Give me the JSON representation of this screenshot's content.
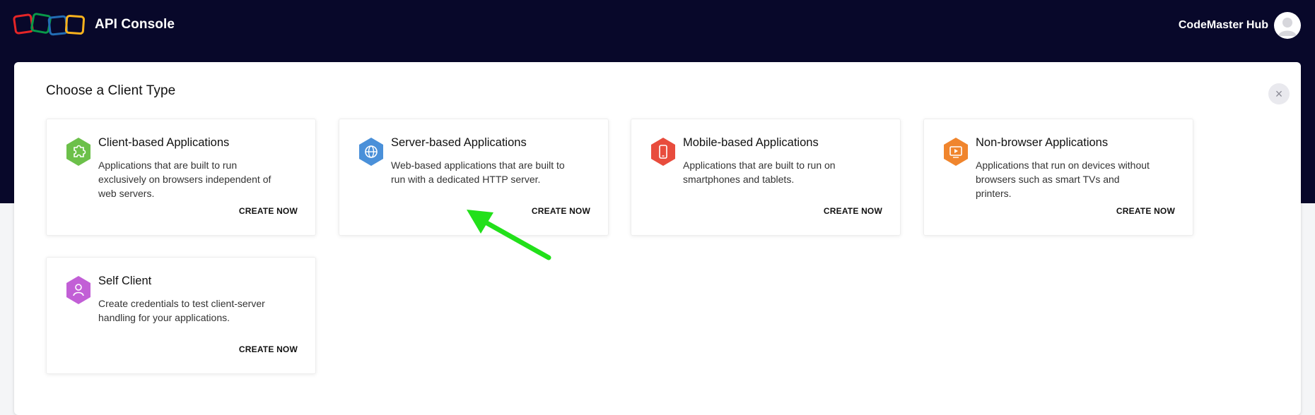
{
  "header": {
    "app_title": "API Console",
    "user_name": "CodeMaster Hub"
  },
  "modal": {
    "title": "Choose a Client Type",
    "close_label": "×"
  },
  "cards": [
    {
      "title": "Client-based Applications",
      "description": "Applications that are built to run exclusively on browsers independent of web servers.",
      "cta": "CREATE NOW",
      "icon": "puzzle-icon",
      "color": "#6cc04a"
    },
    {
      "title": "Server-based Applications",
      "description": "Web-based applications that are built to run with a dedicated HTTP server.",
      "cta": "CREATE NOW",
      "icon": "globe-icon",
      "color": "#4a90d9"
    },
    {
      "title": "Mobile-based Applications",
      "description": "Applications that are built to run on smartphones and tablets.",
      "cta": "CREATE NOW",
      "icon": "smartphone-icon",
      "color": "#e84c3d"
    },
    {
      "title": "Non-browser Applications",
      "description": "Applications that run on devices without browsers such as smart TVs and printers.",
      "cta": "CREATE NOW",
      "icon": "tv-play-icon",
      "color": "#f0852d"
    },
    {
      "title": "Self Client",
      "description": "Create credentials to test client-server handling for your applications.",
      "cta": "CREATE NOW",
      "icon": "user-icon",
      "color": "#c25fd6"
    }
  ],
  "colors": {
    "header_bg": "#08082a",
    "annotation_arrow": "#22e01a"
  }
}
